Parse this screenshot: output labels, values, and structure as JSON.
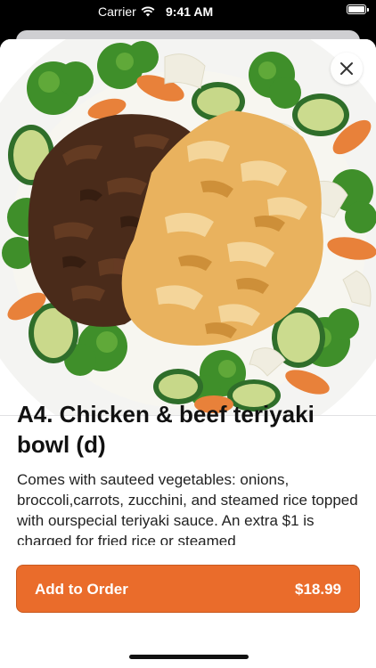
{
  "status_bar": {
    "carrier": "Carrier",
    "time": "9:41 AM",
    "wifi_icon": "wifi-icon",
    "battery_icon": "battery-icon"
  },
  "item": {
    "title": "A4. Chicken & beef teriyaki bowl (d)",
    "description": "Comes with sauteed vegetables: onions, broccoli,carrots, zucchini, and steamed rice topped with ourspecial teriyaki sauce. An extra $1 is charged for fried rice or steamed",
    "image_icon": "food-photo"
  },
  "close": {
    "icon": "close-icon"
  },
  "order": {
    "button_label": "Add to Order",
    "price": "$18.99"
  },
  "colors": {
    "accent": "#ea6c2b",
    "sheet_background": "#ffffff",
    "backdrop": "#000000"
  }
}
